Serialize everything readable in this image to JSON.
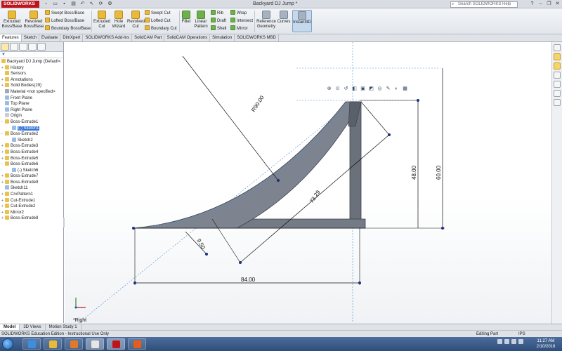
{
  "app": {
    "logo": "SOLIDWORKS",
    "document_title": "Backyard DJ Jump *",
    "search_placeholder": "Search SOLIDWORKS Help",
    "quick_access_icons": [
      "new-icon",
      "open-icon",
      "save-icon",
      "print-icon",
      "undo-icon",
      "select-icon",
      "rebuild-icon",
      "options-icon"
    ]
  },
  "ribbon": {
    "extruded_boss": "Extruded Boss/Base",
    "revolved_boss": "Revolved Boss/Base",
    "swept_boss": "Swept Boss/Base",
    "lofted_boss": "Lofted Boss/Base",
    "boundary_boss": "Boundary Boss/Base",
    "extruded_cut": "Extruded Cut",
    "hole_wizard": "Hole Wizard",
    "revolved_cut": "Revolved Cut",
    "swept_cut": "Swept Cut",
    "lofted_cut": "Lofted Cut",
    "boundary_cut": "Boundary Cut",
    "fillet": "Fillet",
    "linear_pattern": "Linear Pattern",
    "rib": "Rib",
    "draft": "Draft",
    "shell": "Shell",
    "wrap": "Wrap",
    "intersect": "Intersect",
    "mirror": "Mirror",
    "reference_geometry": "Reference Geometry",
    "curves": "Curves",
    "instant3d": "Instant3D"
  },
  "command_tabs": [
    "Features",
    "Sketch",
    "Evaluate",
    "DimXpert",
    "SOLIDWORKS Add-Ins",
    "SolidCAM Part",
    "SolidCAM Operations",
    "Simulation",
    "SOLIDWORKS MBD"
  ],
  "feature_tree": {
    "root": "Backyard DJ Jump  (Default<",
    "items": [
      {
        "label": "History",
        "toggle": "+",
        "color": "#e9c24a"
      },
      {
        "label": "Sensors",
        "toggle": "",
        "color": "#e9c24a"
      },
      {
        "label": "Annotations",
        "toggle": "+",
        "color": "#e9c24a"
      },
      {
        "label": "Solid Bodies(29)",
        "toggle": "+",
        "color": "#e9c24a"
      },
      {
        "label": "Material <not specified>",
        "toggle": "",
        "color": "#a0a8b3"
      },
      {
        "label": "Front Plane",
        "toggle": "",
        "color": "#9bbbe0"
      },
      {
        "label": "Top Plane",
        "toggle": "",
        "color": "#9bbbe0"
      },
      {
        "label": "Right Plane",
        "toggle": "",
        "color": "#9bbbe0"
      },
      {
        "label": "Origin",
        "toggle": "",
        "color": "#c9ced5"
      },
      {
        "label": "Boss-Extrude1",
        "toggle": "-",
        "color": "#e9c24a"
      },
      {
        "label": "(-) Sketch1",
        "toggle": "",
        "color": "#9bbbe0",
        "sub": true,
        "selected": true
      },
      {
        "label": "Boss-Extrude2",
        "toggle": "-",
        "color": "#e9c24a"
      },
      {
        "label": "Sketch2",
        "toggle": "",
        "color": "#9bbbe0",
        "sub": true
      },
      {
        "label": "Boss-Extrude3",
        "toggle": "+",
        "color": "#e9c24a"
      },
      {
        "label": "Boss-Extrude4",
        "toggle": "+",
        "color": "#e9c24a"
      },
      {
        "label": "Boss-Extrude5",
        "toggle": "+",
        "color": "#e9c24a"
      },
      {
        "label": "Boss-Extrude6",
        "toggle": "-",
        "color": "#e9c24a"
      },
      {
        "label": "(-) Sketch6",
        "toggle": "",
        "color": "#9bbbe0",
        "sub": true
      },
      {
        "label": "Boss-Extrude7",
        "toggle": "+",
        "color": "#e9c24a"
      },
      {
        "label": "Boss-Extrude9",
        "toggle": "+",
        "color": "#e9c24a"
      },
      {
        "label": "Sketch11",
        "toggle": "",
        "color": "#9bbbe0"
      },
      {
        "label": "CrvPattern1",
        "toggle": "+",
        "color": "#e9c24a"
      },
      {
        "label": "Cut-Extrude1",
        "toggle": "+",
        "color": "#e9c24a"
      },
      {
        "label": "Cut-Extrude2",
        "toggle": "+",
        "color": "#e9c24a"
      },
      {
        "label": "Mirror2",
        "toggle": "+",
        "color": "#e9c24a"
      },
      {
        "label": "Boss-Extrude8",
        "toggle": "+",
        "color": "#e9c24a"
      }
    ]
  },
  "dimensions": {
    "radius": "R90.00",
    "diagonal": "73.29",
    "height_inner": "48.00",
    "height_outer": "60.00",
    "base_width": "84.00",
    "small": "9.50"
  },
  "view": {
    "orientation": "*Right"
  },
  "bottom_tabs": [
    "Model",
    "3D Views",
    "Motion Study 1"
  ],
  "status": {
    "left": "SOLIDWORKS Education Edition - Instructional Use Only",
    "mode": "Editing Part",
    "units": "IPS"
  },
  "taskbar": {
    "time": "11:27 AM",
    "date": "2/10/2016"
  }
}
